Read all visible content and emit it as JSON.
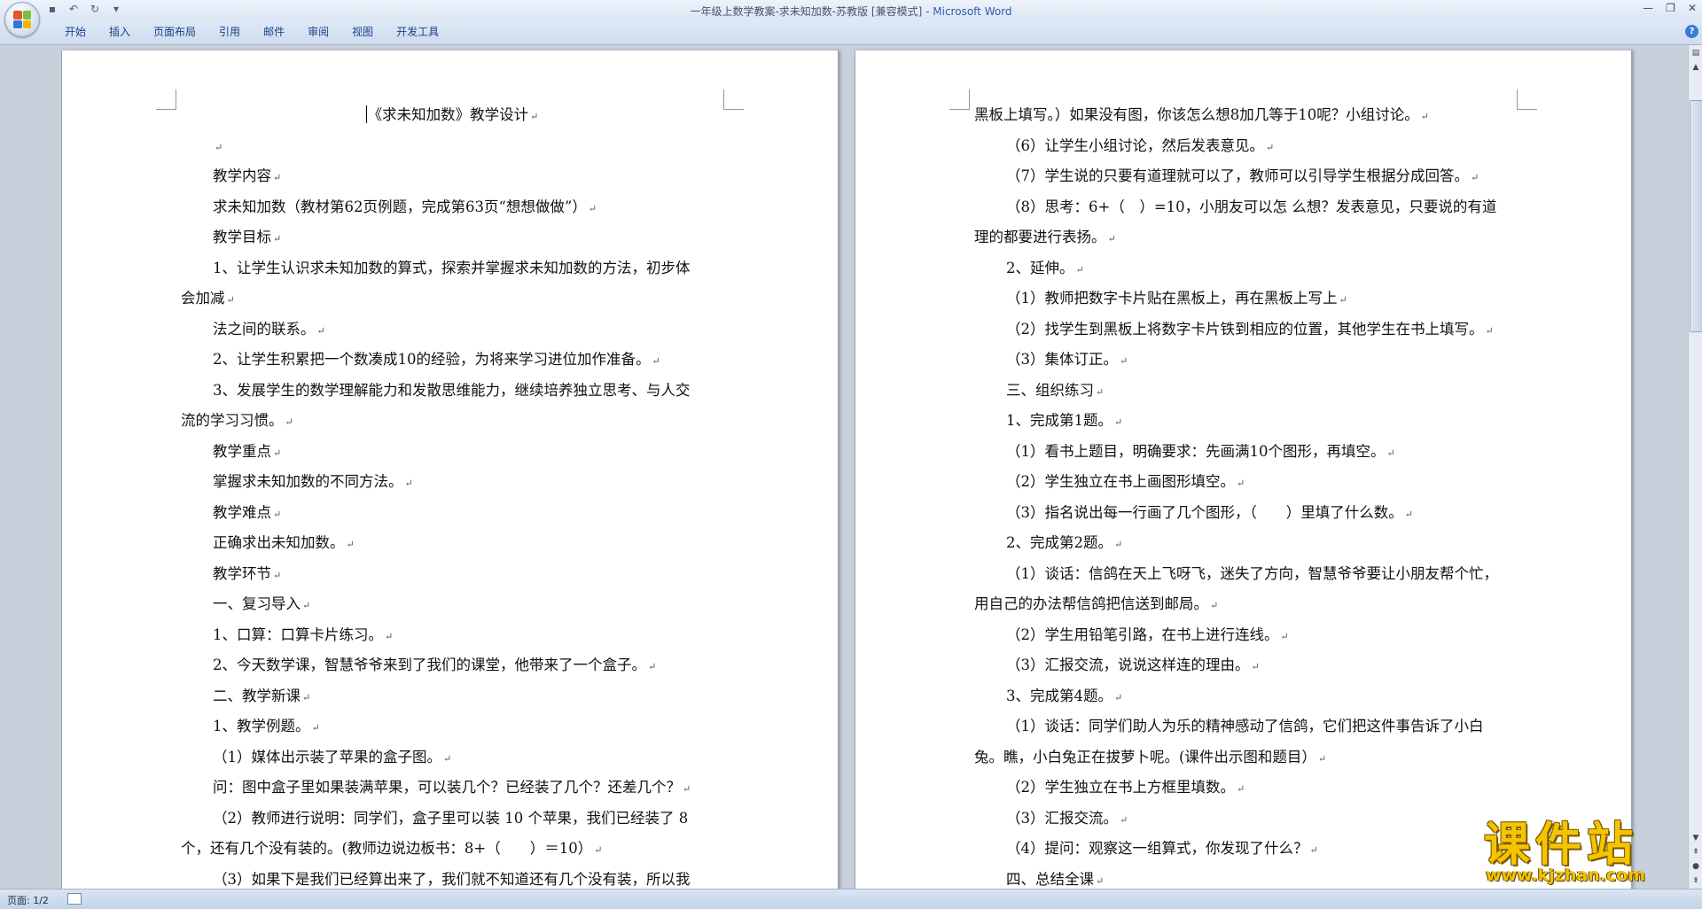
{
  "window": {
    "title": "一年级上数学教案-求未知加数-苏教版 [兼容模式] - ",
    "app_name": "Microsoft Word"
  },
  "ribbon": {
    "tabs": [
      "开始",
      "插入",
      "页面布局",
      "引用",
      "邮件",
      "审阅",
      "视图",
      "开发工具"
    ]
  },
  "document": {
    "left_page": {
      "title": "《求未知加数》教学设计",
      "lines": [
        {
          "text": "",
          "indent": true
        },
        {
          "text": "教学内容",
          "indent": true
        },
        {
          "text": "求未知加数（教材第62页例题，完成第63页“想想做做”）",
          "indent": true
        },
        {
          "text": "教学目标",
          "indent": true
        },
        {
          "text": "1、让学生认识求未知加数的算式，探索并掌握求未知加数的方法，初步体",
          "indent": true,
          "nomark": true
        },
        {
          "text": "会加减",
          "indent": false
        },
        {
          "text": "法之间的联系。",
          "indent": true
        },
        {
          "text": "2、让学生积累把一个数凑成10的经验，为将来学习进位加作准备。",
          "indent": true
        },
        {
          "text": "3、发展学生的数学理解能力和发散思维能力，继续培养独立思考、与人交",
          "indent": true,
          "nomark": true
        },
        {
          "text": "流的学习习惯。",
          "indent": false
        },
        {
          "text": "教学重点",
          "indent": true
        },
        {
          "text": "掌握求未知加数的不同方法。",
          "indent": true
        },
        {
          "text": "教学难点",
          "indent": true
        },
        {
          "text": "正确求出未知加数。",
          "indent": true
        },
        {
          "text": "教学环节",
          "indent": true
        },
        {
          "text": "一、复习导入",
          "indent": true
        },
        {
          "text": "1、口算：口算卡片练习。",
          "indent": true
        },
        {
          "text": "2、今天数学课，智慧爷爷来到了我们的课堂，他带来了一个盒子。",
          "indent": true
        },
        {
          "text": "二、教学新课",
          "indent": true
        },
        {
          "text": "1、教学例题。",
          "indent": true
        },
        {
          "text": "（1）媒体出示装了苹果的盒子图。",
          "indent": true
        },
        {
          "text": "问：图中盒子里如果装满苹果，可以装几个？已经装了几个？还差几个？",
          "indent": true
        },
        {
          "text": "（2）教师进行说明：同学们，盒子里可以装 10 个苹果，我们已经装了 8",
          "indent": true,
          "nomark": true
        },
        {
          "text": "个，还有几个没有装的。(教师边说边板书：8+（　　）＝10）",
          "indent": false
        },
        {
          "text": "（3）如果下是我们已经算出来了，我们就不知道还有几个没有装，所以我",
          "indent": true,
          "nomark": true
        }
      ]
    },
    "right_page": {
      "lines": [
        {
          "text": "黑板上填写。）如果没有图，你该怎么想8加几等于10呢？小组讨论。",
          "indent": false
        },
        {
          "text": "（6）让学生小组讨论，然后发表意见。",
          "indent": true
        },
        {
          "text": "（7）学生说的只要有道理就可以了，教师可以引导学生根据分成回答。",
          "indent": true
        },
        {
          "text": "（8）思考：6+（　）=10，小朋友可以怎  么想？发表意见，只要说的有道",
          "indent": true,
          "nomark": true
        },
        {
          "text": "理的都要进行表扬。",
          "indent": false
        },
        {
          "text": "2、延伸。",
          "indent": true
        },
        {
          "text": "（1）教师把数字卡片贴在黑板上，再在黑板上写上",
          "indent": true
        },
        {
          "text": "（2）找学生到黑板上将数字卡片铁到相应的位置，其他学生在书上填写。",
          "indent": true
        },
        {
          "text": "（3）集体订正。",
          "indent": true
        },
        {
          "text": "三、组织练习",
          "indent": true
        },
        {
          "text": "1、完成第1题。",
          "indent": true
        },
        {
          "text": "（1）看书上题目，明确要求：先画满10个图形，再填空。",
          "indent": true
        },
        {
          "text": "（2）学生独立在书上画图形填空。",
          "indent": true
        },
        {
          "text": "（3）指名说出每一行画了几个图形，（　　）里填了什么数。",
          "indent": true
        },
        {
          "text": "2、完成第2题。",
          "indent": true
        },
        {
          "text": "（1）谈话：信鸽在天上飞呀飞，迷失了方向，智慧爷爷要让小朋友帮个忙，",
          "indent": true,
          "nomark": true
        },
        {
          "text": "用自己的办法帮信鸽把信送到邮局。",
          "indent": false
        },
        {
          "text": "（2）学生用铅笔引路，在书上进行连线。",
          "indent": true
        },
        {
          "text": "（3）汇报交流，说说这样连的理由。",
          "indent": true
        },
        {
          "text": "3、完成第4题。",
          "indent": true
        },
        {
          "text": "（1）谈话：同学们助人为乐的精神感动了信鸽，它们把这件事告诉了小白",
          "indent": true,
          "nomark": true
        },
        {
          "text": "兔。瞧，小白兔正在拔萝卜呢。(课件出示图和题目）",
          "indent": false
        },
        {
          "text": "（2）学生独立在书上方框里填数。",
          "indent": true
        },
        {
          "text": "（3）汇报交流。",
          "indent": true
        },
        {
          "text": "（4）提问：观察这一组算式，你发现了什么？",
          "indent": true
        },
        {
          "text": "四、总结全课",
          "indent": true
        }
      ]
    }
  },
  "status_bar": {
    "page_info": "页面: 1/2"
  },
  "watermark": {
    "brand": "课件站",
    "url": "www.kjzhan.com"
  },
  "colors": {
    "accent": "#2f5ea8",
    "ribbon_text": "#15428b",
    "watermark": "#f5c400"
  }
}
